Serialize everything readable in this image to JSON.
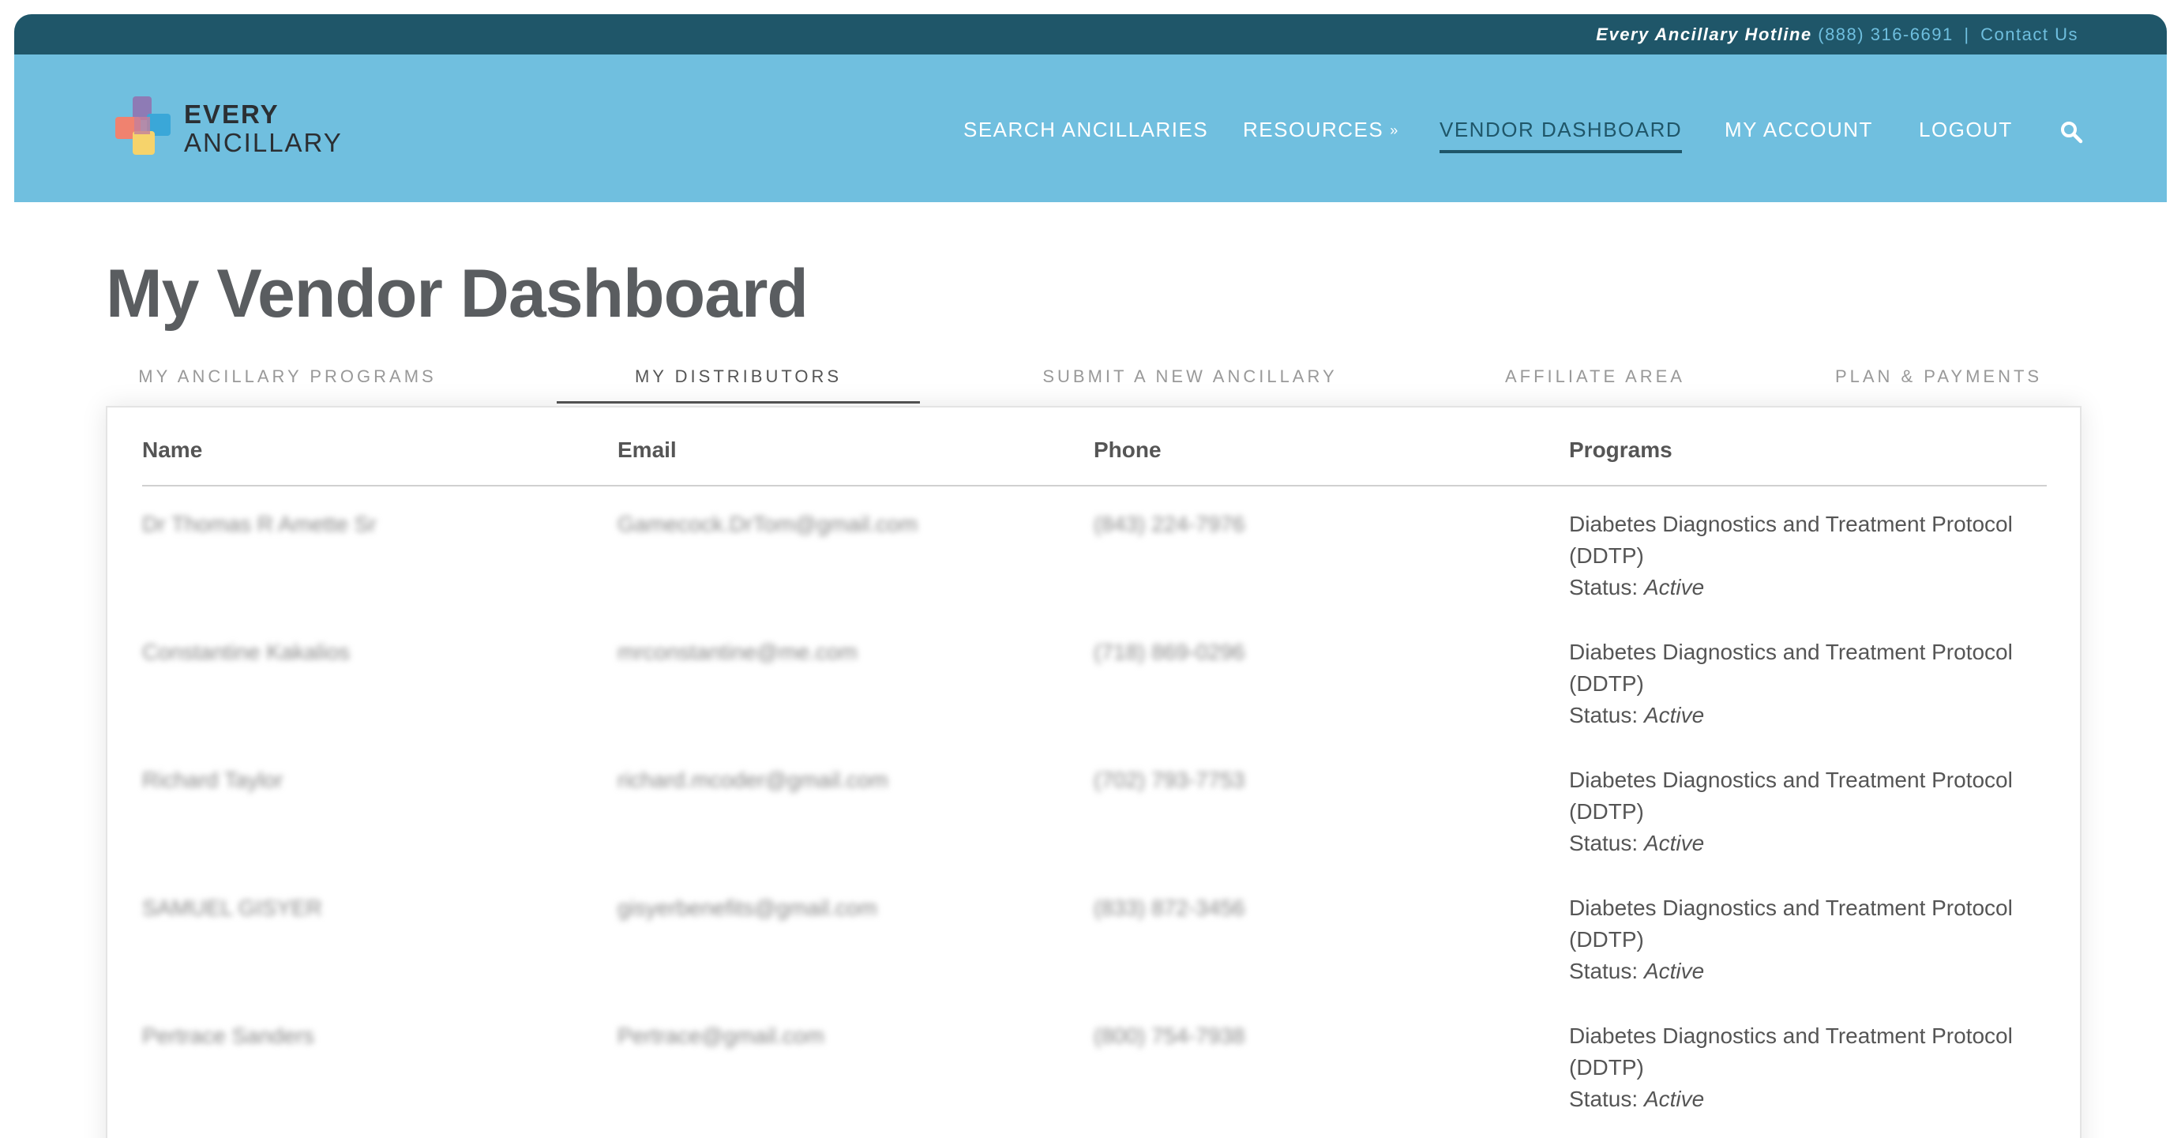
{
  "topbar": {
    "hotline_label": "Every Ancillary Hotline",
    "phone": "(888) 316-6691",
    "separator": "|",
    "contact_link": "Contact Us"
  },
  "logo": {
    "line1": "EVERY",
    "line2": "ANCILLARY"
  },
  "nav": {
    "items": [
      {
        "label": "SEARCH ANCILLARIES"
      },
      {
        "label": "RESOURCES",
        "chevron": "»"
      },
      {
        "label": "VENDOR DASHBOARD",
        "active": true
      },
      {
        "label": "MY ACCOUNT"
      },
      {
        "label": "LOGOUT"
      }
    ],
    "search_icon": "search-icon"
  },
  "page": {
    "title": "My Vendor Dashboard"
  },
  "tabs": [
    {
      "label": "MY ANCILLARY PROGRAMS"
    },
    {
      "label": "MY DISTRIBUTORS",
      "active": true
    },
    {
      "label": "SUBMIT A NEW ANCILLARY"
    },
    {
      "label": "AFFILIATE AREA"
    },
    {
      "label": "PLAN & PAYMENTS"
    }
  ],
  "table": {
    "headers": [
      "Name",
      "Email",
      "Phone",
      "Programs"
    ],
    "rows": [
      {
        "name": "Dr Thomas R Amette Sr",
        "email": "Gamecock.DrTom@gmail.com",
        "phone": "(843) 224-7976",
        "program": "Diabetes Diagnostics and Treatment Protocol (DDTP)",
        "status_label": "Status:",
        "status": "Active"
      },
      {
        "name": "Constantine Kakalios",
        "email": "mrconstantine@me.com",
        "phone": "(718) 869-0296",
        "program": "Diabetes Diagnostics and Treatment Protocol (DDTP)",
        "status_label": "Status:",
        "status": "Active"
      },
      {
        "name": "Richard Taylor",
        "email": "richard.mcoder@gmail.com",
        "phone": "(702) 793-7753",
        "program": "Diabetes Diagnostics and Treatment Protocol (DDTP)",
        "status_label": "Status:",
        "status": "Active"
      },
      {
        "name": "SAMUEL GISYER",
        "email": "gisyerbenefits@gmail.com",
        "phone": "(833) 872-3456",
        "program": "Diabetes Diagnostics and Treatment Protocol (DDTP)",
        "status_label": "Status:",
        "status": "Active"
      },
      {
        "name": "Pertrace Sanders",
        "email": "Pertrace@gmail.com",
        "phone": "(800) 754-7938",
        "program": "Diabetes Diagnostics and Treatment Protocol (DDTP)",
        "status_label": "Status:",
        "status": "Active"
      }
    ]
  },
  "colors": {
    "topbar": "#1f5669",
    "header": "#70bfdf",
    "accent_link": "#6fbfdf",
    "title": "#5a5d60"
  }
}
